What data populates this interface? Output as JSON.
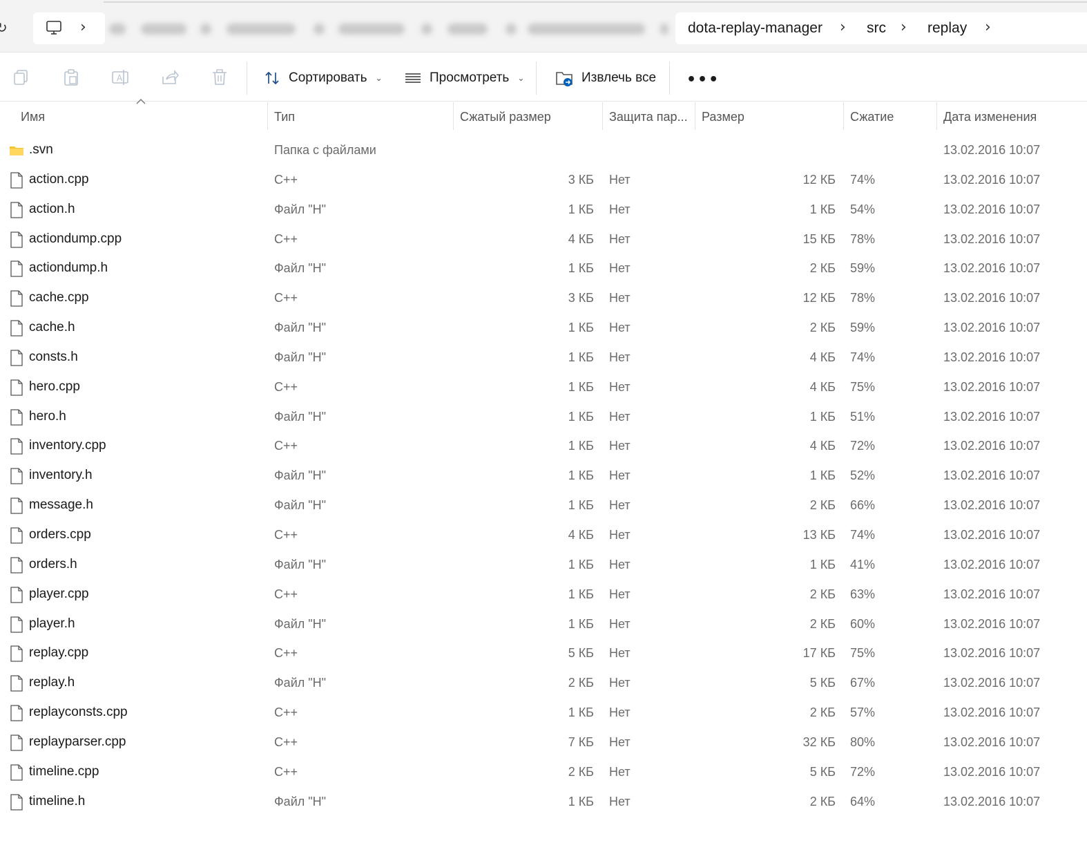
{
  "address_bar": {
    "breadcrumbs": [
      "dota-replay-manager",
      "src",
      "replay"
    ]
  },
  "toolbar": {
    "sort_label": "Сортировать",
    "view_label": "Просмотреть",
    "extract_label": "Извлечь все"
  },
  "columns": {
    "name": "Имя",
    "type": "Тип",
    "compressed": "Сжатый размер",
    "protected": "Защита пар...",
    "size": "Размер",
    "ratio": "Сжатие",
    "modified": "Дата изменения"
  },
  "files": [
    {
      "name": ".svn",
      "type": "Папка с файлами",
      "compressed": "",
      "protected": "",
      "size": "",
      "ratio": "",
      "modified": "13.02.2016 10:07",
      "icon": "folder-icon"
    },
    {
      "name": "action.cpp",
      "type": "C++",
      "compressed": "3 КБ",
      "protected": "Нет",
      "size": "12 КБ",
      "ratio": "74%",
      "modified": "13.02.2016 10:07",
      "icon": "file-icon"
    },
    {
      "name": "action.h",
      "type": "Файл \"H\"",
      "compressed": "1 КБ",
      "protected": "Нет",
      "size": "1 КБ",
      "ratio": "54%",
      "modified": "13.02.2016 10:07",
      "icon": "file-icon"
    },
    {
      "name": "actiondump.cpp",
      "type": "C++",
      "compressed": "4 КБ",
      "protected": "Нет",
      "size": "15 КБ",
      "ratio": "78%",
      "modified": "13.02.2016 10:07",
      "icon": "file-icon"
    },
    {
      "name": "actiondump.h",
      "type": "Файл \"H\"",
      "compressed": "1 КБ",
      "protected": "Нет",
      "size": "2 КБ",
      "ratio": "59%",
      "modified": "13.02.2016 10:07",
      "icon": "file-icon"
    },
    {
      "name": "cache.cpp",
      "type": "C++",
      "compressed": "3 КБ",
      "protected": "Нет",
      "size": "12 КБ",
      "ratio": "78%",
      "modified": "13.02.2016 10:07",
      "icon": "file-icon"
    },
    {
      "name": "cache.h",
      "type": "Файл \"H\"",
      "compressed": "1 КБ",
      "protected": "Нет",
      "size": "2 КБ",
      "ratio": "59%",
      "modified": "13.02.2016 10:07",
      "icon": "file-icon"
    },
    {
      "name": "consts.h",
      "type": "Файл \"H\"",
      "compressed": "1 КБ",
      "protected": "Нет",
      "size": "4 КБ",
      "ratio": "74%",
      "modified": "13.02.2016 10:07",
      "icon": "file-icon"
    },
    {
      "name": "hero.cpp",
      "type": "C++",
      "compressed": "1 КБ",
      "protected": "Нет",
      "size": "4 КБ",
      "ratio": "75%",
      "modified": "13.02.2016 10:07",
      "icon": "file-icon"
    },
    {
      "name": "hero.h",
      "type": "Файл \"H\"",
      "compressed": "1 КБ",
      "protected": "Нет",
      "size": "1 КБ",
      "ratio": "51%",
      "modified": "13.02.2016 10:07",
      "icon": "file-icon"
    },
    {
      "name": "inventory.cpp",
      "type": "C++",
      "compressed": "1 КБ",
      "protected": "Нет",
      "size": "4 КБ",
      "ratio": "72%",
      "modified": "13.02.2016 10:07",
      "icon": "file-icon"
    },
    {
      "name": "inventory.h",
      "type": "Файл \"H\"",
      "compressed": "1 КБ",
      "protected": "Нет",
      "size": "1 КБ",
      "ratio": "52%",
      "modified": "13.02.2016 10:07",
      "icon": "file-icon"
    },
    {
      "name": "message.h",
      "type": "Файл \"H\"",
      "compressed": "1 КБ",
      "protected": "Нет",
      "size": "2 КБ",
      "ratio": "66%",
      "modified": "13.02.2016 10:07",
      "icon": "file-icon"
    },
    {
      "name": "orders.cpp",
      "type": "C++",
      "compressed": "4 КБ",
      "protected": "Нет",
      "size": "13 КБ",
      "ratio": "74%",
      "modified": "13.02.2016 10:07",
      "icon": "file-icon"
    },
    {
      "name": "orders.h",
      "type": "Файл \"H\"",
      "compressed": "1 КБ",
      "protected": "Нет",
      "size": "1 КБ",
      "ratio": "41%",
      "modified": "13.02.2016 10:07",
      "icon": "file-icon"
    },
    {
      "name": "player.cpp",
      "type": "C++",
      "compressed": "1 КБ",
      "protected": "Нет",
      "size": "2 КБ",
      "ratio": "63%",
      "modified": "13.02.2016 10:07",
      "icon": "file-icon"
    },
    {
      "name": "player.h",
      "type": "Файл \"H\"",
      "compressed": "1 КБ",
      "protected": "Нет",
      "size": "2 КБ",
      "ratio": "60%",
      "modified": "13.02.2016 10:07",
      "icon": "file-icon"
    },
    {
      "name": "replay.cpp",
      "type": "C++",
      "compressed": "5 КБ",
      "protected": "Нет",
      "size": "17 КБ",
      "ratio": "75%",
      "modified": "13.02.2016 10:07",
      "icon": "file-icon"
    },
    {
      "name": "replay.h",
      "type": "Файл \"H\"",
      "compressed": "2 КБ",
      "protected": "Нет",
      "size": "5 КБ",
      "ratio": "67%",
      "modified": "13.02.2016 10:07",
      "icon": "file-icon"
    },
    {
      "name": "replayconsts.cpp",
      "type": "C++",
      "compressed": "1 КБ",
      "protected": "Нет",
      "size": "2 КБ",
      "ratio": "57%",
      "modified": "13.02.2016 10:07",
      "icon": "file-icon"
    },
    {
      "name": "replayparser.cpp",
      "type": "C++",
      "compressed": "7 КБ",
      "protected": "Нет",
      "size": "32 КБ",
      "ratio": "80%",
      "modified": "13.02.2016 10:07",
      "icon": "file-icon"
    },
    {
      "name": "timeline.cpp",
      "type": "C++",
      "compressed": "2 КБ",
      "protected": "Нет",
      "size": "5 КБ",
      "ratio": "72%",
      "modified": "13.02.2016 10:07",
      "icon": "file-icon"
    },
    {
      "name": "timeline.h",
      "type": "Файл \"H\"",
      "compressed": "1 КБ",
      "protected": "Нет",
      "size": "2 КБ",
      "ratio": "64%",
      "modified": "13.02.2016 10:07",
      "icon": "file-icon"
    }
  ],
  "colors": {
    "folder": "#f4c430",
    "accent": "#005fb8"
  }
}
